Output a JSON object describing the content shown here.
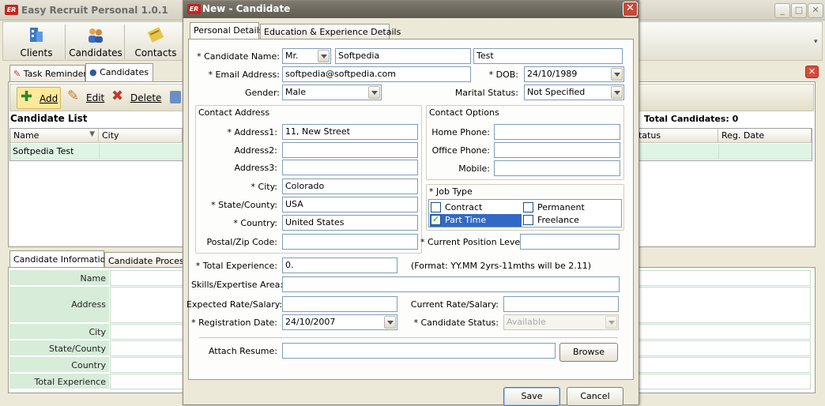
{
  "main": {
    "title": "Easy Recruit Personal 1.0.1",
    "toolbar": [
      "Clients",
      "Candidates",
      "Contacts"
    ],
    "tabs": [
      "Task Reminder",
      "Candidates"
    ],
    "actions": {
      "add": "Add",
      "edit": "Edit",
      "delete": "Delete"
    },
    "list_title": "Candidate List",
    "total": "Total Candidates: 0",
    "columns": [
      "Name",
      "City",
      "Status",
      "Reg. Date"
    ],
    "rows": [
      {
        "name": "Softpedia Test"
      }
    ],
    "info_tabs": [
      "Candidate Information",
      "Candidate Process D"
    ],
    "info_fields": [
      "Name",
      "Address",
      "City",
      "State/County",
      "Country",
      "Total Experience"
    ]
  },
  "dialog": {
    "title": "New - Candidate",
    "tabs": [
      "Personal Details",
      "Education & Experience Details"
    ],
    "candidate_name": {
      "label": "* Candidate Name:",
      "salutation": "Mr.",
      "first": "Softpedia",
      "last": "Test"
    },
    "email": {
      "label": "* Email Address:",
      "value": "softpedia@softpedia.com"
    },
    "dob": {
      "label": "* DOB:",
      "value": "24/10/1989"
    },
    "gender": {
      "label": "Gender:",
      "value": "Male"
    },
    "marital": {
      "label": "Marital Status:",
      "value": "Not Specified"
    },
    "contact_address": {
      "title": "Contact Address",
      "address1": {
        "label": "* Address1:",
        "value": "11, New Street"
      },
      "address2": {
        "label": "Address2:",
        "value": ""
      },
      "address3": {
        "label": "Address3:",
        "value": ""
      },
      "city": {
        "label": "* City:",
        "value": "Colorado"
      },
      "state": {
        "label": "* State/County:",
        "value": "USA"
      },
      "country": {
        "label": "* Country:",
        "value": "United States"
      },
      "postal": {
        "label": "Postal/Zip Code:",
        "value": ""
      }
    },
    "contact_options": {
      "title": "Contact Options",
      "home": {
        "label": "Home Phone:",
        "value": ""
      },
      "office": {
        "label": "Office Phone:",
        "value": ""
      },
      "mobile": {
        "label": "Mobile:",
        "value": ""
      }
    },
    "job_type": {
      "title": "* Job Type",
      "options": [
        {
          "label": "Contract",
          "checked": false
        },
        {
          "label": "Permanent",
          "checked": false
        },
        {
          "label": "Part Time",
          "checked": true
        },
        {
          "label": "Freelance",
          "checked": false
        }
      ]
    },
    "position_level": {
      "label": "* Current Position Level:",
      "value": ""
    },
    "total_experience": {
      "label": "* Total Experience:",
      "value": "0.",
      "hint": "(Format: YY.MM   2yrs-11mths will be  2.11)"
    },
    "skills": {
      "label": "Skills/Expertise Area:",
      "value": ""
    },
    "expected_rate": {
      "label": "Expected Rate/Salary:",
      "value": ""
    },
    "current_rate": {
      "label": "Current Rate/Salary:",
      "value": ""
    },
    "registration_date": {
      "label": "* Registration Date:",
      "value": "24/10/2007"
    },
    "candidate_status": {
      "label": "* Candidate Status:",
      "value": "Available"
    },
    "attach_resume": {
      "label": "Attach Resume:",
      "value": "",
      "browse": "Browse"
    },
    "save": "Save",
    "cancel": "Cancel"
  },
  "colors": {
    "accent": "#e0f4e5",
    "info_label_bg": "#d7ecd9",
    "dialog_title": "#6c6960",
    "selected": "#316ac5"
  }
}
